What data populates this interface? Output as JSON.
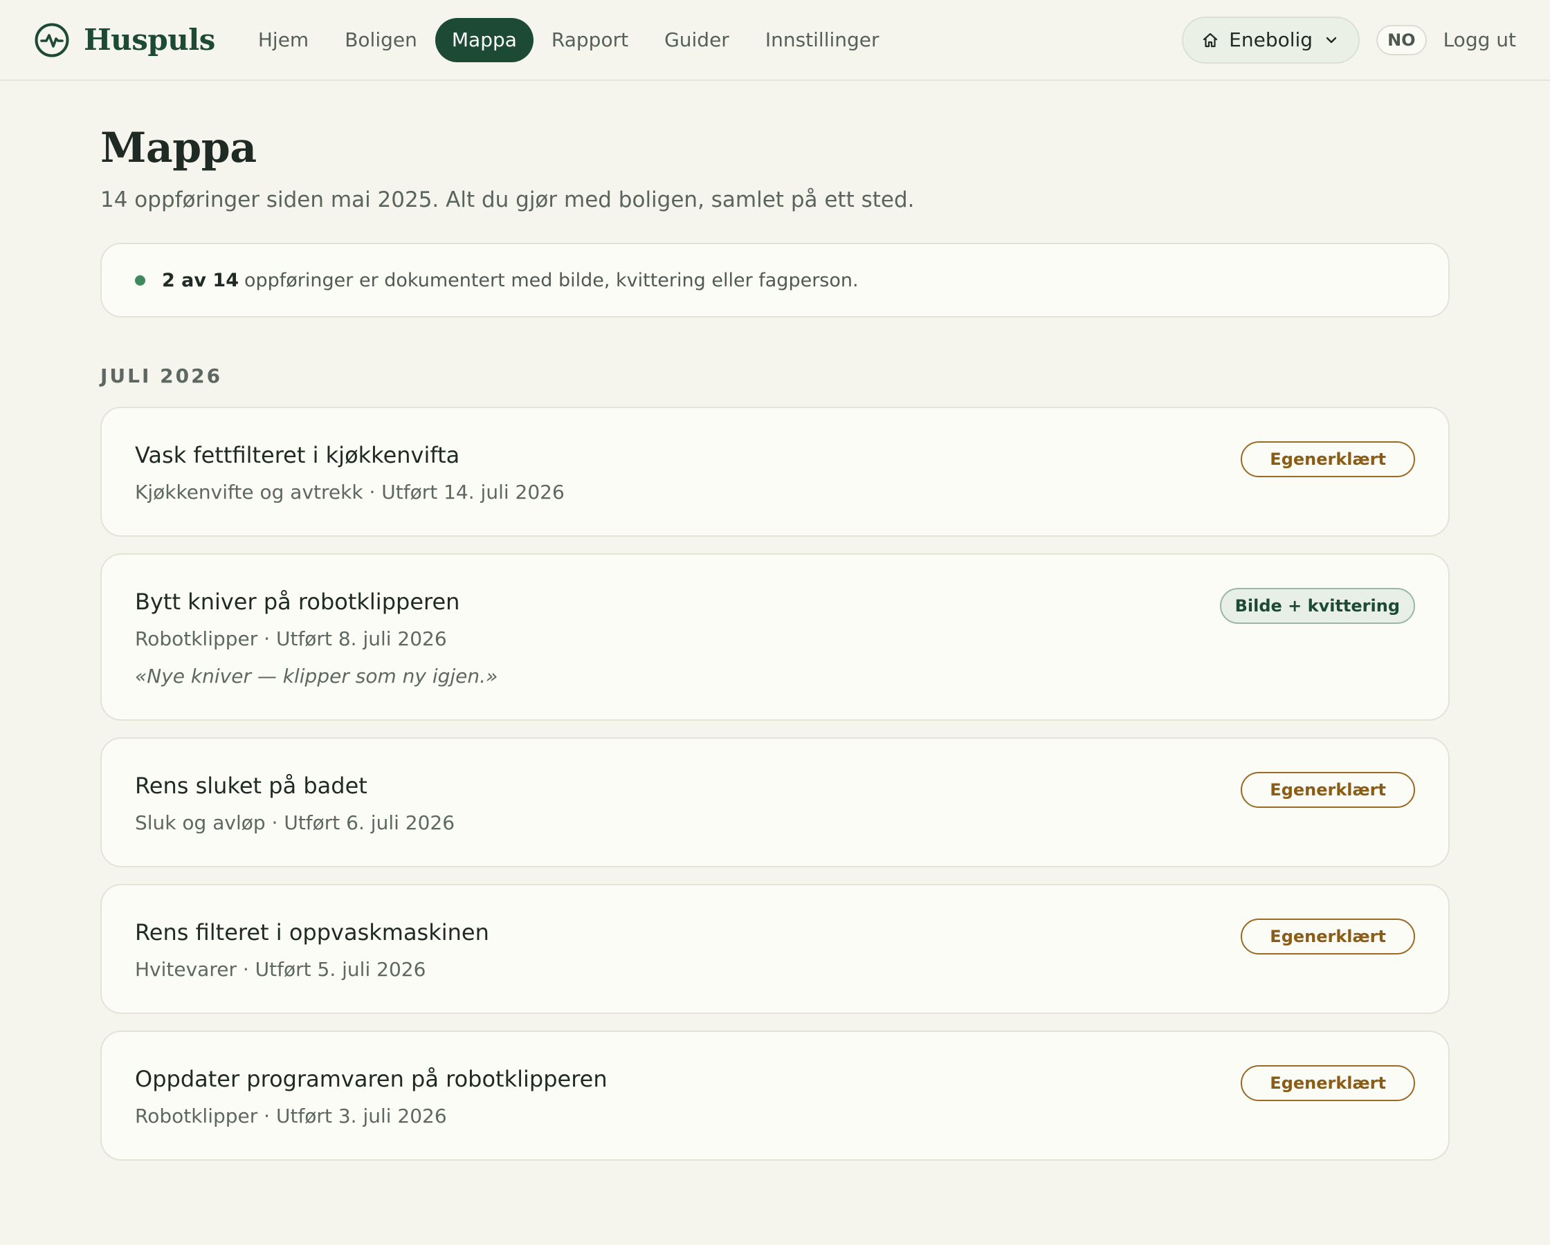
{
  "brand": {
    "name": "Huspuls",
    "icon": "pulse-icon"
  },
  "nav": {
    "items": [
      {
        "label": "Hjem",
        "active": false
      },
      {
        "label": "Boligen",
        "active": false
      },
      {
        "label": "Mappa",
        "active": true
      },
      {
        "label": "Rapport",
        "active": false
      },
      {
        "label": "Guider",
        "active": false
      },
      {
        "label": "Innstillinger",
        "active": false
      }
    ]
  },
  "header": {
    "home_select": "Enebolig",
    "language": "NO",
    "logout": "Logg ut"
  },
  "page": {
    "title": "Mappa",
    "subtitle": "14 oppføringer siden mai 2025. Alt du gjør med boligen, samlet på ett sted."
  },
  "summary": {
    "strong": "2 av 14",
    "text": "oppføringer er dokumentert med bilde, kvittering eller fagperson."
  },
  "section": {
    "heading": "JULI 2026"
  },
  "entries": [
    {
      "title": "Vask fettfilteret i kjøkkenvifta",
      "meta": "Kjøkkenvifte og avtrekk · Utført 14. juli 2026",
      "badge": "Egenerklært",
      "note": ""
    },
    {
      "title": "Bytt kniver på robotklipperen",
      "meta": "Robotklipper · Utført 8. juli 2026",
      "badge": "Bilde + kvittering",
      "note": "«Nye kniver — klipper som ny igjen.»"
    },
    {
      "title": "Rens sluket på badet",
      "meta": "Sluk og avløp · Utført 6. juli 2026",
      "badge": "Egenerklært",
      "note": ""
    },
    {
      "title": "Rens filteret i oppvaskmaskinen",
      "meta": "Hvitevarer · Utført 5. juli 2026",
      "badge": "Egenerklært",
      "note": ""
    },
    {
      "title": "Oppdater programvaren på robotklipperen",
      "meta": "Robotklipper · Utført 3. juli 2026",
      "badge": "Egenerklært",
      "note": ""
    }
  ],
  "colors": {
    "brand": "#1d4a35",
    "background": "#f5f5ed",
    "self_badge": "#8a5c16",
    "docs_badge": "#1d4a35",
    "status_dot": "#3e8a5e"
  }
}
